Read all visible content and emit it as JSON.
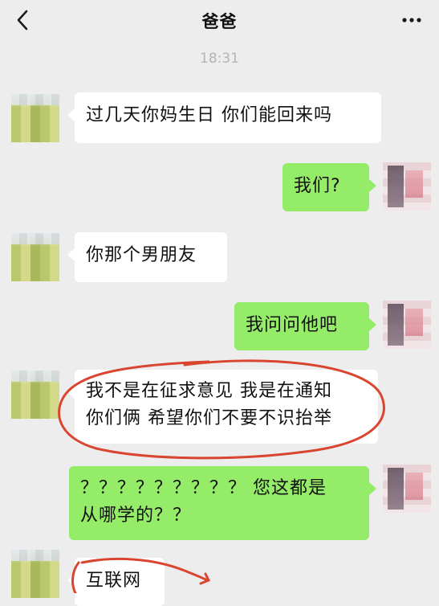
{
  "header": {
    "back_icon": "chevron-left-icon",
    "title": "爸爸",
    "more_icon": "ellipsis-icon"
  },
  "chat": {
    "timestamp": "18:31",
    "messages": [
      {
        "from": "other",
        "text": "过几天你妈生日 你们能回来吗"
      },
      {
        "from": "me",
        "text": "我们?"
      },
      {
        "from": "other",
        "text": "你那个男朋友"
      },
      {
        "from": "me",
        "text": "我问问他吧"
      },
      {
        "from": "other",
        "text": "我不是在征求意见 我是在通知\n你们俩 希望你们不要不识抬举"
      },
      {
        "from": "me",
        "text": "？？？？？？？？？ 您这都是\n从哪学的？？"
      },
      {
        "from": "other",
        "text": "互联网"
      }
    ]
  },
  "annotation": {
    "color": "#d9452f"
  }
}
